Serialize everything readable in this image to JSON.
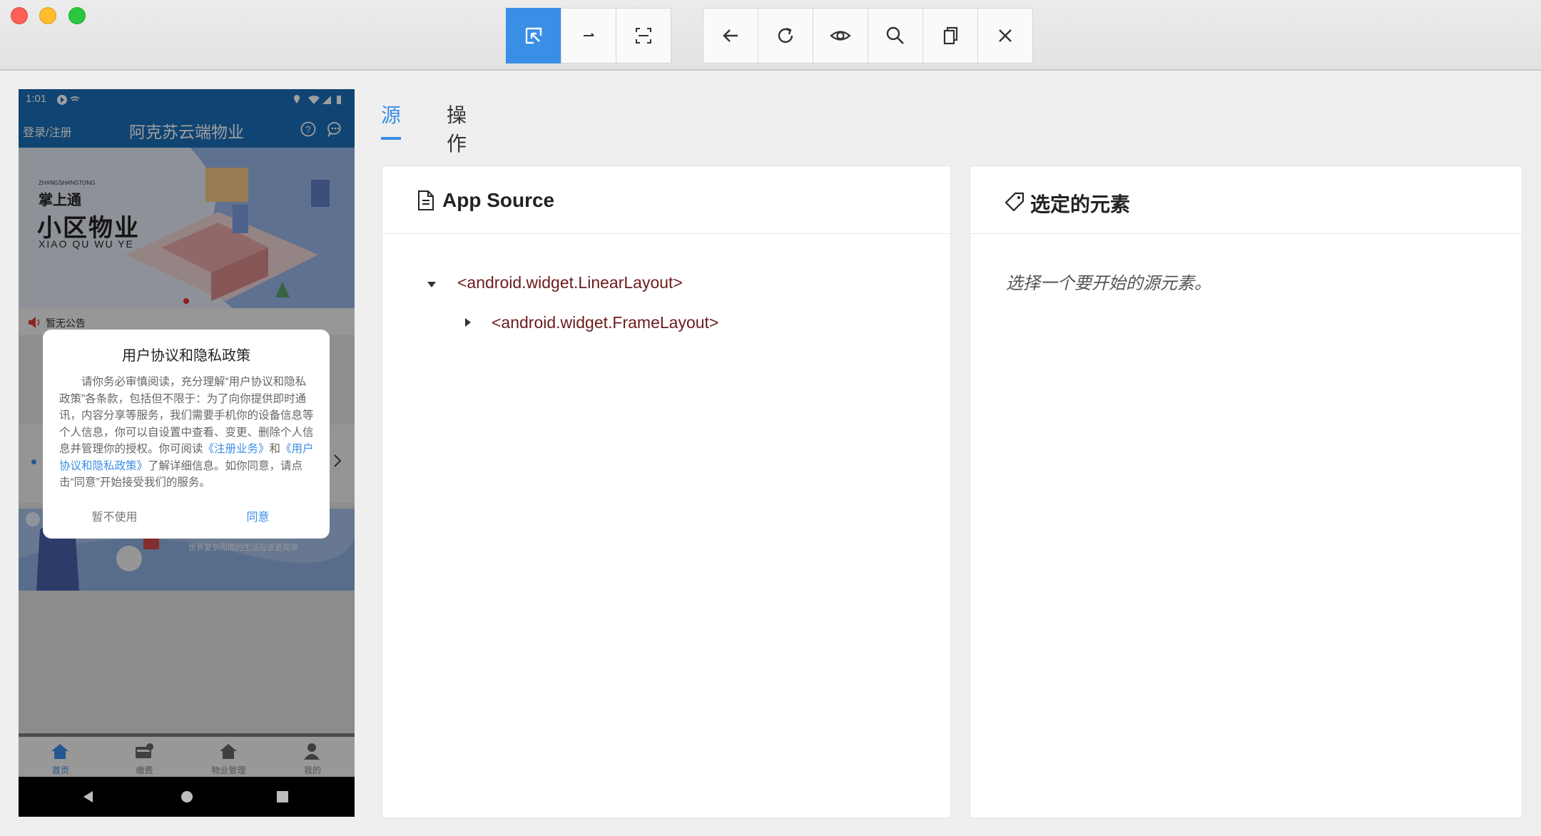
{
  "toolbar": {
    "group1": [
      {
        "name": "select-element-icon",
        "active": true
      },
      {
        "name": "swipe-arrow-icon",
        "active": false
      },
      {
        "name": "tap-by-coordinates-icon",
        "active": false
      }
    ],
    "group2": [
      {
        "name": "back-arrow-icon"
      },
      {
        "name": "refresh-icon"
      },
      {
        "name": "eye-icon"
      },
      {
        "name": "search-icon"
      },
      {
        "name": "copy-icon"
      },
      {
        "name": "close-icon"
      }
    ]
  },
  "phone": {
    "status": {
      "time": "1:01"
    },
    "header": {
      "login": "登录/注册",
      "title": "阿克苏云端物业"
    },
    "banner": {
      "small": "ZHANGSHANGTONG",
      "line1": "掌上通",
      "line2": "小区物业",
      "line3": "XIAO QU WU YE"
    },
    "notice": "暂无公告",
    "lower_caption": "世界复杂而简约生活应该更简单",
    "dialog": {
      "title": "用户协议和隐私政策",
      "body_1": "请你务必审慎阅读，充分理解“用户协议和隐私政策”各条款，包括但不限于：为了向你提供即时通讯，内容分享等服务，我们需要手机你的设备信息等个人信息，你可以自设置中查看、变更、删除个人信息并管理你的授权。你可阅读",
      "link_1": "《注册业务》",
      "and": "和",
      "link_2": "《用户协议和隐私政策》",
      "body_2": "了解详细信息。如你同意，请点击“同意”开始接受我们的服务。",
      "decline": "暂不使用",
      "accept": "同意"
    },
    "tabs": [
      "首页",
      "缴费",
      "物业管理",
      "我的"
    ]
  },
  "inspector": {
    "tab_source": "源",
    "tab_actions": "操作",
    "source_title": "App Source",
    "tree": [
      {
        "label": "<android.widget.LinearLayout>",
        "expanded": true
      },
      {
        "label": "<android.widget.FrameLayout>",
        "expanded": false
      }
    ],
    "selected_title": "选定的元素",
    "selected_placeholder": "选择一个要开始的源元素。"
  },
  "colors": {
    "accent": "#3a8ee6",
    "tree_text": "#6d1b1b",
    "app_blue": "#1b6fb8"
  }
}
